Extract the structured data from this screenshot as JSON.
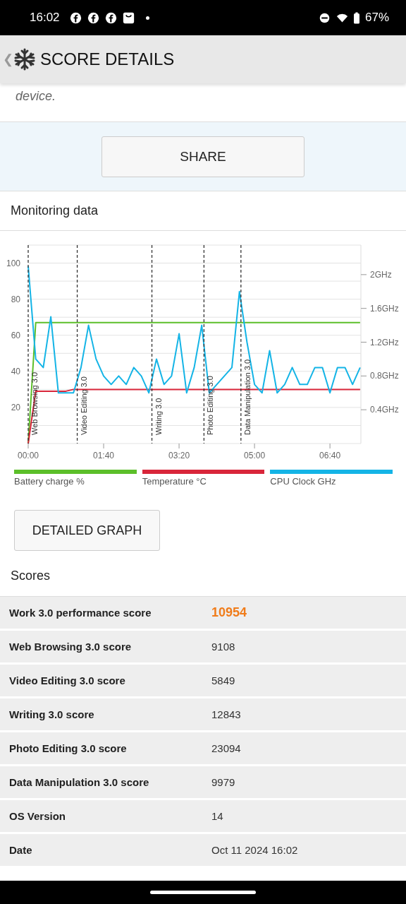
{
  "status_bar": {
    "time": "16:02",
    "battery": "67%"
  },
  "header": {
    "back": "❮",
    "title": "SCORE DETAILS"
  },
  "note": "device.",
  "share_button": "SHARE",
  "monitoring": {
    "title": "Monitoring data",
    "chart_data": {
      "type": "line",
      "xlim": [
        0,
        441
      ],
      "ylim": [
        0,
        110
      ],
      "y2lim": [
        0,
        2.35
      ],
      "xticks": [
        {
          "value": 0,
          "label": "00:00"
        },
        {
          "value": 100,
          "label": "01:40"
        },
        {
          "value": 200,
          "label": "03:20"
        },
        {
          "value": 300,
          "label": "05:00"
        },
        {
          "value": 400,
          "label": "06:40"
        }
      ],
      "yticks": [
        20,
        40,
        60,
        80,
        100
      ],
      "y2ticks": [
        {
          "value": 0.4,
          "label": "0.4GHz"
        },
        {
          "value": 0.8,
          "label": "0.8GHz"
        },
        {
          "value": 1.2,
          "label": "1.2GHz"
        },
        {
          "value": 1.6,
          "label": "1.6GHz"
        },
        {
          "value": 2,
          "label": "2GHz"
        }
      ],
      "x": [
        0,
        10,
        20,
        30,
        40,
        50,
        60,
        70,
        80,
        90,
        100,
        110,
        120,
        130,
        140,
        150,
        160,
        170,
        180,
        190,
        200,
        210,
        220,
        230,
        240,
        250,
        260,
        270,
        280,
        290,
        300,
        310,
        320,
        330,
        340,
        350,
        360,
        370,
        380,
        390,
        400,
        410,
        420,
        430,
        440
      ],
      "series": [
        {
          "name": "Battery charge %",
          "color": "#5cbf2a",
          "values": [
            0,
            67,
            67,
            67,
            67,
            67,
            67,
            67,
            67,
            67,
            67,
            67,
            67,
            67,
            67,
            67,
            67,
            67,
            67,
            67,
            67,
            67,
            67,
            67,
            67,
            67,
            67,
            67,
            67,
            67,
            67,
            67,
            67,
            67,
            67,
            67,
            67,
            67,
            67,
            67,
            67,
            67,
            67,
            67,
            67
          ]
        },
        {
          "name": "Temperature °C",
          "color": "#d9263a",
          "values": [
            0,
            29,
            29,
            29,
            29,
            29,
            30,
            30,
            30,
            30,
            30,
            30,
            30,
            30,
            30,
            30,
            30,
            30,
            30,
            30,
            30,
            30,
            30,
            30,
            30,
            30,
            30,
            30,
            30,
            30,
            30,
            30,
            30,
            30,
            30,
            30,
            30,
            30,
            30,
            30,
            30,
            30,
            30,
            30,
            30
          ]
        },
        {
          "name": "CPU Clock GHz",
          "color": "#14b4e6",
          "axis": "y2",
          "values": [
            2.1,
            1.0,
            0.9,
            1.5,
            0.6,
            0.6,
            0.6,
            0.9,
            1.4,
            1.0,
            0.8,
            0.7,
            0.8,
            0.7,
            0.9,
            0.8,
            0.6,
            1.0,
            0.7,
            0.8,
            1.3,
            0.6,
            0.9,
            1.4,
            0.6,
            0.7,
            0.8,
            0.9,
            1.8,
            1.2,
            0.7,
            0.6,
            1.1,
            0.6,
            0.7,
            0.9,
            0.7,
            0.7,
            0.9,
            0.9,
            0.6,
            0.9,
            0.9,
            0.7,
            0.9
          ]
        }
      ],
      "grid": true,
      "ref_lines": [
        {
          "axis": "x",
          "value": 0,
          "label": "Web Browsing 3.0"
        },
        {
          "axis": "x",
          "value": 65,
          "label": "Video Editing 3.0"
        },
        {
          "axis": "x",
          "value": 164,
          "label": "Writing 3.0"
        },
        {
          "axis": "x",
          "value": 233,
          "label": "Photo Editing 3.0"
        },
        {
          "axis": "x",
          "value": 282,
          "label": "Data Manipulation 3.0"
        }
      ]
    },
    "detailed_graph_button": "DETAILED GRAPH"
  },
  "scores": {
    "title": "Scores",
    "rows": [
      {
        "label": "Work 3.0 performance score",
        "value": "10954",
        "kind": "highlight"
      },
      {
        "label": "Web Browsing 3.0 score",
        "value": "9108",
        "kind": "plain"
      },
      {
        "label": "Video Editing 3.0 score",
        "value": "5849",
        "kind": "plain"
      },
      {
        "label": "Writing 3.0 score",
        "value": "12843",
        "kind": "plain"
      },
      {
        "label": "Photo Editing 3.0 score",
        "value": "23094",
        "kind": "plain"
      },
      {
        "label": "Data Manipulation 3.0 score",
        "value": "9979",
        "kind": "plain"
      },
      {
        "label": "OS Version",
        "value": "14",
        "kind": "plain"
      },
      {
        "label": "Date",
        "value": "Oct 11 2024 16:02",
        "kind": "plain"
      }
    ]
  }
}
